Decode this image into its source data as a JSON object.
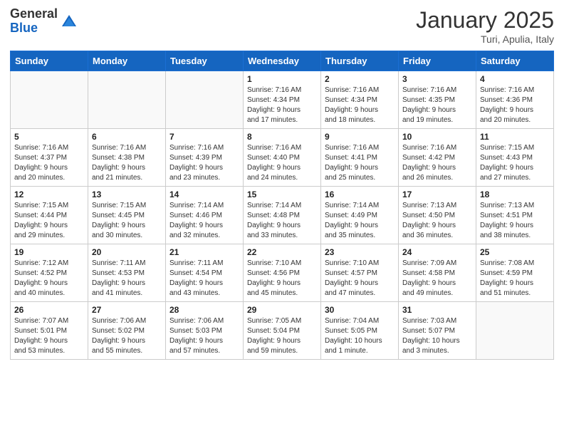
{
  "header": {
    "logo_general": "General",
    "logo_blue": "Blue",
    "month_title": "January 2025",
    "location": "Turi, Apulia, Italy"
  },
  "days_of_week": [
    "Sunday",
    "Monday",
    "Tuesday",
    "Wednesday",
    "Thursday",
    "Friday",
    "Saturday"
  ],
  "weeks": [
    [
      {
        "day": "",
        "info": ""
      },
      {
        "day": "",
        "info": ""
      },
      {
        "day": "",
        "info": ""
      },
      {
        "day": "1",
        "info": "Sunrise: 7:16 AM\nSunset: 4:34 PM\nDaylight: 9 hours\nand 17 minutes."
      },
      {
        "day": "2",
        "info": "Sunrise: 7:16 AM\nSunset: 4:34 PM\nDaylight: 9 hours\nand 18 minutes."
      },
      {
        "day": "3",
        "info": "Sunrise: 7:16 AM\nSunset: 4:35 PM\nDaylight: 9 hours\nand 19 minutes."
      },
      {
        "day": "4",
        "info": "Sunrise: 7:16 AM\nSunset: 4:36 PM\nDaylight: 9 hours\nand 20 minutes."
      }
    ],
    [
      {
        "day": "5",
        "info": "Sunrise: 7:16 AM\nSunset: 4:37 PM\nDaylight: 9 hours\nand 20 minutes."
      },
      {
        "day": "6",
        "info": "Sunrise: 7:16 AM\nSunset: 4:38 PM\nDaylight: 9 hours\nand 21 minutes."
      },
      {
        "day": "7",
        "info": "Sunrise: 7:16 AM\nSunset: 4:39 PM\nDaylight: 9 hours\nand 23 minutes."
      },
      {
        "day": "8",
        "info": "Sunrise: 7:16 AM\nSunset: 4:40 PM\nDaylight: 9 hours\nand 24 minutes."
      },
      {
        "day": "9",
        "info": "Sunrise: 7:16 AM\nSunset: 4:41 PM\nDaylight: 9 hours\nand 25 minutes."
      },
      {
        "day": "10",
        "info": "Sunrise: 7:16 AM\nSunset: 4:42 PM\nDaylight: 9 hours\nand 26 minutes."
      },
      {
        "day": "11",
        "info": "Sunrise: 7:15 AM\nSunset: 4:43 PM\nDaylight: 9 hours\nand 27 minutes."
      }
    ],
    [
      {
        "day": "12",
        "info": "Sunrise: 7:15 AM\nSunset: 4:44 PM\nDaylight: 9 hours\nand 29 minutes."
      },
      {
        "day": "13",
        "info": "Sunrise: 7:15 AM\nSunset: 4:45 PM\nDaylight: 9 hours\nand 30 minutes."
      },
      {
        "day": "14",
        "info": "Sunrise: 7:14 AM\nSunset: 4:46 PM\nDaylight: 9 hours\nand 32 minutes."
      },
      {
        "day": "15",
        "info": "Sunrise: 7:14 AM\nSunset: 4:48 PM\nDaylight: 9 hours\nand 33 minutes."
      },
      {
        "day": "16",
        "info": "Sunrise: 7:14 AM\nSunset: 4:49 PM\nDaylight: 9 hours\nand 35 minutes."
      },
      {
        "day": "17",
        "info": "Sunrise: 7:13 AM\nSunset: 4:50 PM\nDaylight: 9 hours\nand 36 minutes."
      },
      {
        "day": "18",
        "info": "Sunrise: 7:13 AM\nSunset: 4:51 PM\nDaylight: 9 hours\nand 38 minutes."
      }
    ],
    [
      {
        "day": "19",
        "info": "Sunrise: 7:12 AM\nSunset: 4:52 PM\nDaylight: 9 hours\nand 40 minutes."
      },
      {
        "day": "20",
        "info": "Sunrise: 7:11 AM\nSunset: 4:53 PM\nDaylight: 9 hours\nand 41 minutes."
      },
      {
        "day": "21",
        "info": "Sunrise: 7:11 AM\nSunset: 4:54 PM\nDaylight: 9 hours\nand 43 minutes."
      },
      {
        "day": "22",
        "info": "Sunrise: 7:10 AM\nSunset: 4:56 PM\nDaylight: 9 hours\nand 45 minutes."
      },
      {
        "day": "23",
        "info": "Sunrise: 7:10 AM\nSunset: 4:57 PM\nDaylight: 9 hours\nand 47 minutes."
      },
      {
        "day": "24",
        "info": "Sunrise: 7:09 AM\nSunset: 4:58 PM\nDaylight: 9 hours\nand 49 minutes."
      },
      {
        "day": "25",
        "info": "Sunrise: 7:08 AM\nSunset: 4:59 PM\nDaylight: 9 hours\nand 51 minutes."
      }
    ],
    [
      {
        "day": "26",
        "info": "Sunrise: 7:07 AM\nSunset: 5:01 PM\nDaylight: 9 hours\nand 53 minutes."
      },
      {
        "day": "27",
        "info": "Sunrise: 7:06 AM\nSunset: 5:02 PM\nDaylight: 9 hours\nand 55 minutes."
      },
      {
        "day": "28",
        "info": "Sunrise: 7:06 AM\nSunset: 5:03 PM\nDaylight: 9 hours\nand 57 minutes."
      },
      {
        "day": "29",
        "info": "Sunrise: 7:05 AM\nSunset: 5:04 PM\nDaylight: 9 hours\nand 59 minutes."
      },
      {
        "day": "30",
        "info": "Sunrise: 7:04 AM\nSunset: 5:05 PM\nDaylight: 10 hours\nand 1 minute."
      },
      {
        "day": "31",
        "info": "Sunrise: 7:03 AM\nSunset: 5:07 PM\nDaylight: 10 hours\nand 3 minutes."
      },
      {
        "day": "",
        "info": ""
      }
    ]
  ]
}
